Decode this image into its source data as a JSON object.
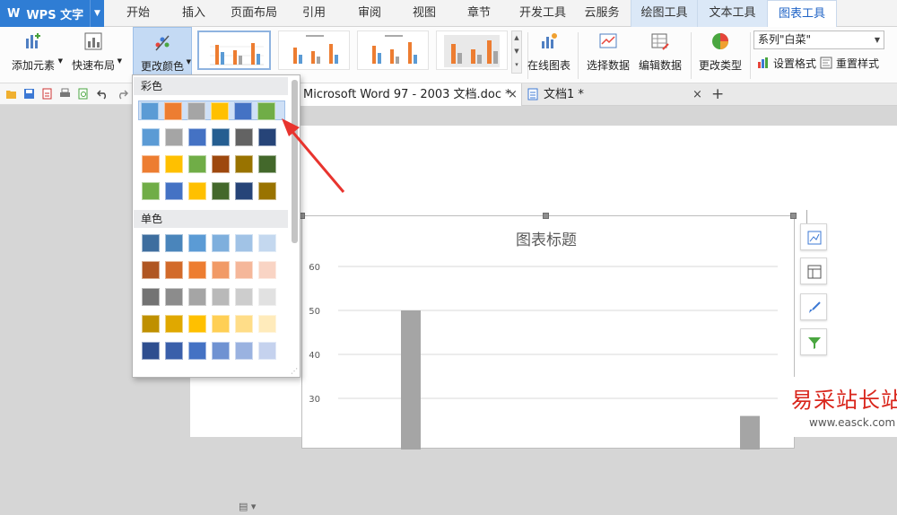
{
  "app": {
    "name": "WPS 文字",
    "logo": "W"
  },
  "menu": {
    "tabs": [
      "开始",
      "插入",
      "页面布局",
      "引用",
      "审阅",
      "视图",
      "章节",
      "开发工具",
      "云服务"
    ],
    "context_tabs": [
      "绘图工具",
      "文本工具"
    ],
    "active_tab": "图表工具"
  },
  "ribbon": {
    "add_element": "添加元素",
    "quick_layout": "快速布局",
    "change_color": "更改颜色",
    "online_chart": "在线图表",
    "select_data": "选择数据",
    "edit_data": "编辑数据",
    "change_type": "更改类型",
    "series_select": "系列\"白菜\"",
    "set_format": "设置格式",
    "reset_style": "重置样式"
  },
  "doc_tabs": {
    "tab1": "Microsoft Word 97 - 2003 文档.doc *",
    "tab2": "文档1 *",
    "close_symbol": "×",
    "new_symbol": "+"
  },
  "color_panel": {
    "section_colorful": "彩色",
    "section_mono": "单色",
    "colorful_rows": [
      [
        "#5b9bd5",
        "#ed7d31",
        "#a5a5a5",
        "#ffc000",
        "#4472c4",
        "#70ad47"
      ],
      [
        "#5b9bd5",
        "#a5a5a5",
        "#4472c4",
        "#255e91",
        "#636363",
        "#264478"
      ],
      [
        "#ed7d31",
        "#ffc000",
        "#70ad47",
        "#9e480e",
        "#997300",
        "#43682b"
      ],
      [
        "#70ad47",
        "#4472c4",
        "#ffc000",
        "#43682b",
        "#264478",
        "#997300"
      ]
    ],
    "mono_rows": [
      [
        "#3e6e9f",
        "#4a85bb",
        "#5b9bd5",
        "#7eafdd",
        "#a1c3e6",
        "#c4d8ef"
      ],
      [
        "#b05622",
        "#d26a2a",
        "#ed7d31",
        "#f19a66",
        "#f5b79a",
        "#f9d4c4"
      ],
      [
        "#737373",
        "#8c8c8c",
        "#a5a5a5",
        "#b9b9b9",
        "#cdcdcd",
        "#e1e1e1"
      ],
      [
        "#bf9000",
        "#e0a800",
        "#ffc000",
        "#ffcf55",
        "#ffdd88",
        "#ffebbb"
      ],
      [
        "#2e4e8f",
        "#3a5faa",
        "#4472c4",
        "#6f92d2",
        "#9ab2e0",
        "#c5d2ee"
      ]
    ]
  },
  "chart_data": {
    "type": "bar",
    "title": "图表标题",
    "yticks": [
      60,
      50,
      40,
      30
    ],
    "ylim": [
      0,
      60
    ],
    "values": [
      50,
      26
    ],
    "bar_color": "#a5a5a5"
  },
  "watermark": {
    "cn": "易采站长站",
    "url": "www.easck.com"
  },
  "colors": {
    "accent": "#2f7dd4",
    "arrow": "#e8342e"
  }
}
